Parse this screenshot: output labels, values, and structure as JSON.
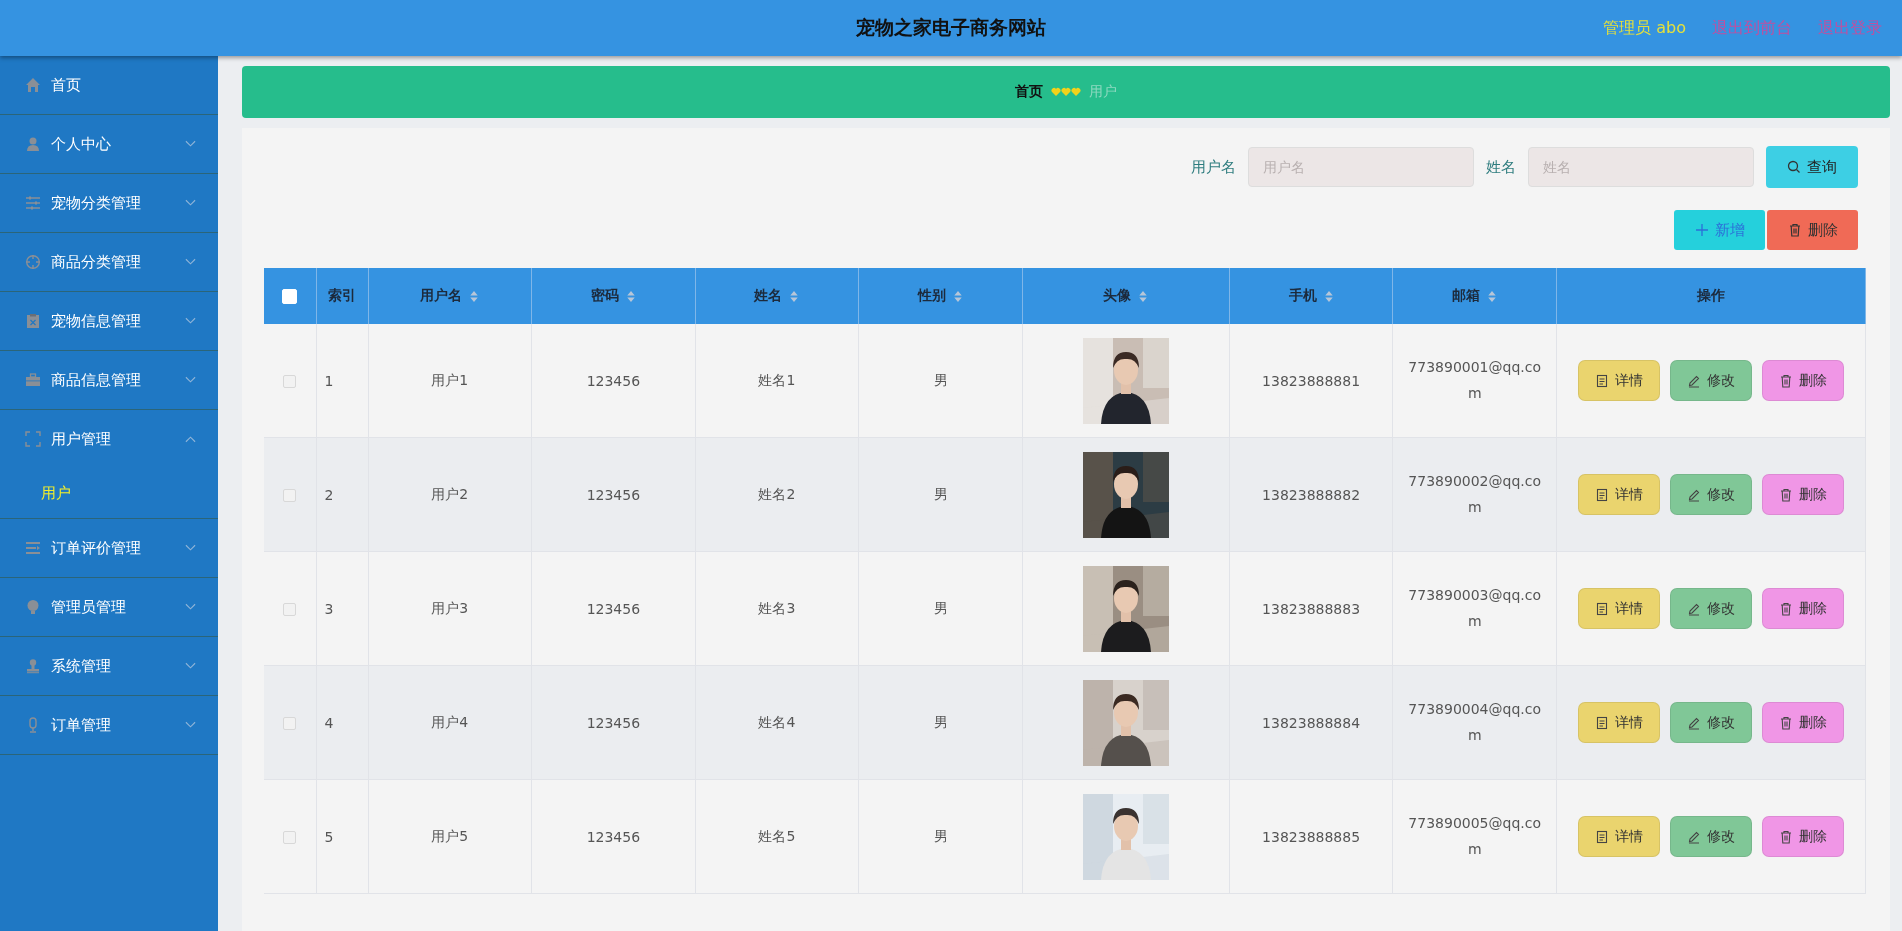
{
  "header": {
    "title": "宠物之家电子商务网站",
    "user": "管理员 abo",
    "links": [
      "退出到前台",
      "退出登录"
    ]
  },
  "sidebar": {
    "items": [
      {
        "label": "首页",
        "kind": "link"
      },
      {
        "label": "个人中心",
        "kind": "menu",
        "expanded": false
      },
      {
        "label": "宠物分类管理",
        "kind": "menu",
        "expanded": false
      },
      {
        "label": "商品分类管理",
        "kind": "menu",
        "expanded": false
      },
      {
        "label": "宠物信息管理",
        "kind": "menu",
        "expanded": false
      },
      {
        "label": "商品信息管理",
        "kind": "menu",
        "expanded": false
      },
      {
        "label": "用户管理",
        "kind": "menu",
        "expanded": true,
        "children": [
          {
            "label": "用户",
            "selected": true
          }
        ]
      },
      {
        "label": "订单评价管理",
        "kind": "menu",
        "expanded": false
      },
      {
        "label": "管理员管理",
        "kind": "menu",
        "expanded": false
      },
      {
        "label": "系统管理",
        "kind": "menu",
        "expanded": false
      },
      {
        "label": "订单管理",
        "kind": "menu",
        "expanded": false
      }
    ]
  },
  "breadcrumb": {
    "items": [
      "首页",
      "用户"
    ]
  },
  "search": {
    "fields": [
      {
        "label": "用户名",
        "placeholder": "用户名"
      },
      {
        "label": "姓名",
        "placeholder": "姓名"
      }
    ],
    "button": "查询"
  },
  "actions": [
    {
      "label": "新增",
      "kind": "add"
    },
    {
      "label": "删除",
      "kind": "delete"
    }
  ],
  "table": {
    "select_all": {
      "checked": false
    },
    "columns": [
      {
        "label": "索引",
        "sortable": false
      },
      {
        "label": "用户名",
        "sortable": true
      },
      {
        "label": "密码",
        "sortable": true
      },
      {
        "label": "姓名",
        "sortable": true
      },
      {
        "label": "性别",
        "sortable": true
      },
      {
        "label": "头像",
        "sortable": true
      },
      {
        "label": "手机",
        "sortable": true
      },
      {
        "label": "邮箱",
        "sortable": true
      },
      {
        "label": "操作",
        "sortable": false
      }
    ],
    "rows": [
      {
        "checked": false,
        "index": "1",
        "username": "用户1",
        "password": "123456",
        "name": "姓名1",
        "gender": "男",
        "phone": "13823888881",
        "email": "773890001@qq.com",
        "buttons": [
          {
            "label": "详情",
            "kind": "detail"
          },
          {
            "label": "修改",
            "kind": "edit"
          },
          {
            "label": "删除",
            "kind": "delete"
          }
        ]
      },
      {
        "checked": false,
        "index": "2",
        "username": "用户2",
        "password": "123456",
        "name": "姓名2",
        "gender": "男",
        "phone": "13823888882",
        "email": "773890002@qq.com",
        "buttons": [
          {
            "label": "详情",
            "kind": "detail"
          },
          {
            "label": "修改",
            "kind": "edit"
          },
          {
            "label": "删除",
            "kind": "delete"
          }
        ]
      },
      {
        "checked": false,
        "index": "3",
        "username": "用户3",
        "password": "123456",
        "name": "姓名3",
        "gender": "男",
        "phone": "13823888883",
        "email": "773890003@qq.com",
        "buttons": [
          {
            "label": "详情",
            "kind": "detail"
          },
          {
            "label": "修改",
            "kind": "edit"
          },
          {
            "label": "删除",
            "kind": "delete"
          }
        ]
      },
      {
        "checked": false,
        "index": "4",
        "username": "用户4",
        "password": "123456",
        "name": "姓名4",
        "gender": "男",
        "phone": "13823888884",
        "email": "773890004@qq.com",
        "buttons": [
          {
            "label": "详情",
            "kind": "detail"
          },
          {
            "label": "修改",
            "kind": "edit"
          },
          {
            "label": "删除",
            "kind": "delete"
          }
        ]
      },
      {
        "checked": false,
        "index": "5",
        "username": "用户5",
        "password": "123456",
        "name": "姓名5",
        "gender": "男",
        "phone": "13823888885",
        "email": "773890005@qq.com",
        "buttons": [
          {
            "label": "详情",
            "kind": "detail"
          },
          {
            "label": "修改",
            "kind": "edit"
          },
          {
            "label": "删除",
            "kind": "delete"
          }
        ]
      }
    ]
  }
}
